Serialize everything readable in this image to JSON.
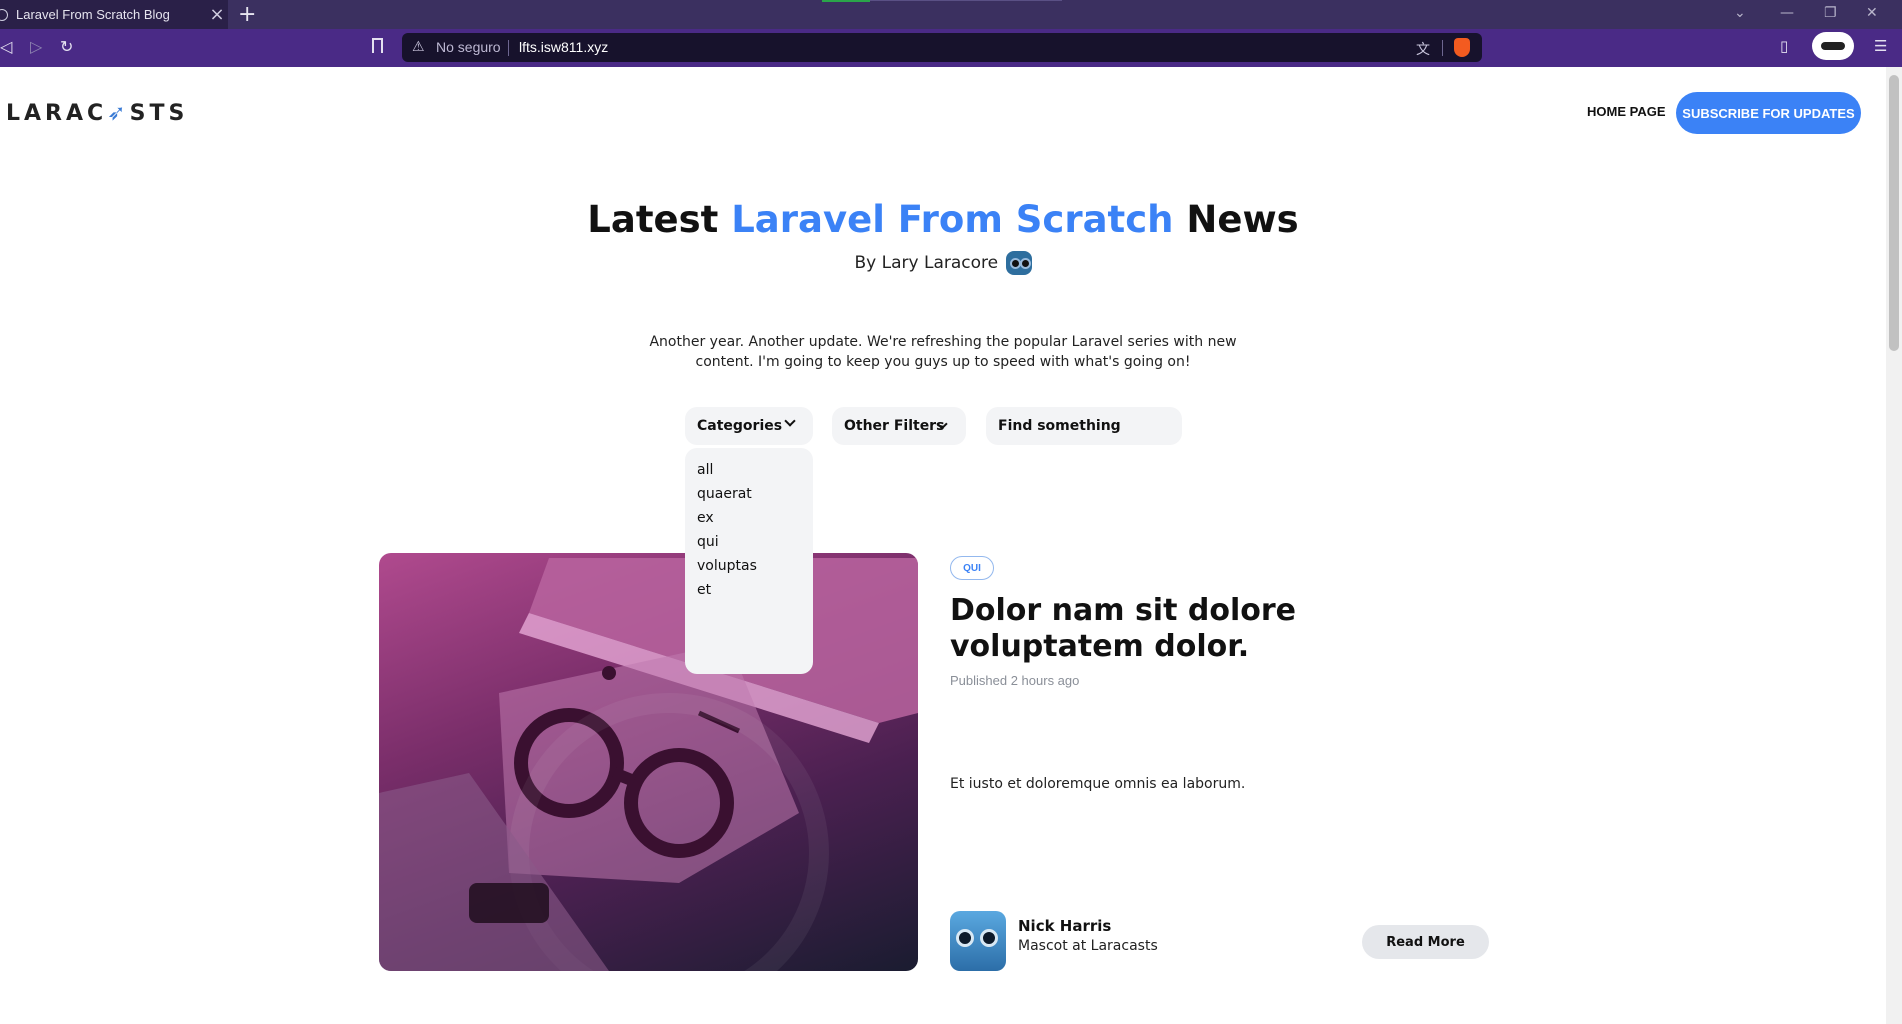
{
  "browser": {
    "tab_title": "Laravel From Scratch Blog",
    "new_tab": "+",
    "close_tab": "×",
    "security_label": "No seguro",
    "url": "lfts.isw811.xyz"
  },
  "header": {
    "logo_text_1": "LARAC",
    "logo_arrow": "➶",
    "logo_text_2": "STS",
    "nav_home": "HOME PAGE",
    "subscribe": "SUBSCRIBE FOR UPDATES"
  },
  "hero": {
    "title_start": "Latest ",
    "title_accent": "Laravel From Scratch",
    "title_end": " News",
    "byline": "By Lary Laracore",
    "intro": "Another year. Another update. We're refreshing the popular Laravel series with new content. I'm going to keep you guys up to speed with what's going on!"
  },
  "filters": {
    "categories_label": "Categories",
    "other_label": "Other Filters",
    "search_placeholder": "Find something",
    "category_options": [
      "all",
      "quaerat",
      "ex",
      "qui",
      "voluptas",
      "et"
    ]
  },
  "post": {
    "category": "QUI",
    "title": "Dolor nam sit dolore voluptatem dolor.",
    "published": "Published 2 hours ago",
    "excerpt": "Et iusto et doloremque omnis ea laborum.",
    "author_name": "Nick Harris",
    "author_role": "Mascot at Laracasts",
    "read_more": "Read More"
  },
  "colors": {
    "accent": "#3b82f6",
    "tabbar": "#3b3060",
    "navbar": "#4a2a86"
  }
}
